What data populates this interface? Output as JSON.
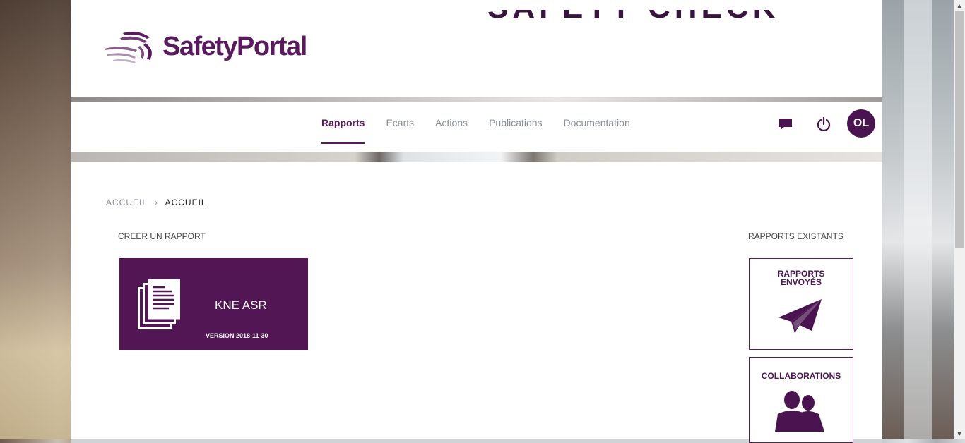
{
  "app": {
    "logo_text": "SafetyPortal",
    "banner_text": "SAFETY CHECK"
  },
  "colors": {
    "brand": "#5a1a5e",
    "brand_dark": "#4a1450",
    "nav_inactive": "#888e96"
  },
  "nav": {
    "items": [
      {
        "label": "Rapports",
        "active": true
      },
      {
        "label": "Ecarts",
        "active": false
      },
      {
        "label": "Actions",
        "active": false
      },
      {
        "label": "Publications",
        "active": false
      },
      {
        "label": "Documentation",
        "active": false
      }
    ],
    "icons": [
      "chat-icon",
      "power-icon"
    ],
    "avatar_initials": "OL"
  },
  "breadcrumb": {
    "items": [
      "ACCUEIL",
      "ACCUEIL"
    ]
  },
  "create_section": {
    "title": "CREER UN RAPPORT",
    "card": {
      "icon": "document-stack-icon",
      "title": "KNE ASR",
      "version": "VERSION 2018-11-30"
    }
  },
  "existing_section": {
    "title": "RAPPORTS EXISTANTS",
    "cards": [
      {
        "title_line1": "RAPPORTS",
        "title_line2": "ENVOYÉS",
        "icon": "paper-plane-icon"
      },
      {
        "title_line1": "COLLABORATIONS",
        "title_line2": "",
        "icon": "users-icon"
      }
    ]
  }
}
